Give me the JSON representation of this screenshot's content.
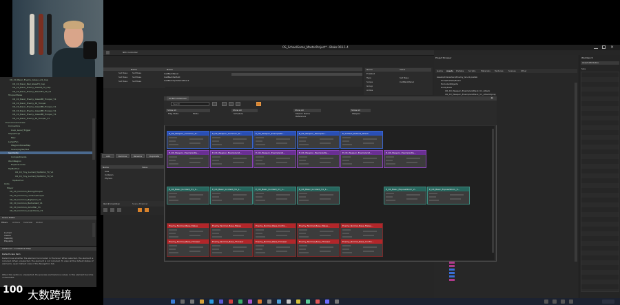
{
  "window": {
    "title": "OS_SchoolGame_MasterProject* - Blake 003.1.4"
  },
  "toolbar": {
    "title": "NPC Controller"
  },
  "dialog": {
    "tab_label": "All BP Containers",
    "search_placeholder": "Search",
    "filters": [
      {
        "header": "Show All",
        "items": [
          "Flag State",
          "Mode"
        ]
      },
      {
        "header": "Show All",
        "items": [
          "Schedule"
        ]
      },
      {
        "header": "Show All",
        "items": [
          "Mission Name",
          "Reference"
        ]
      },
      {
        "header": "Show All",
        "items": [
          "Weapon"
        ]
      }
    ]
  },
  "graph": {
    "rows": [
      {
        "color": "blue",
        "nodes": [
          "E_CR_Weapon_Common_Tr...",
          "E_CR_Weapon_Common_Tr...",
          "E_CR_Weapon_ExampleSt...",
          "E_CR_Weapon_Exemplar...",
          "E_Artifact_Default_Attack"
        ]
      },
      {
        "color": "purple",
        "nodes": [
          "E_CR_Weapon_ExemplarDe...",
          "E_CR_Weapon_ExemplarAt...",
          "E_CR_Weapon_ExemplarAt...",
          "E_CR_Weapon_ExemplarRe...",
          "E_CR_Weapon_ExemplarAt...",
          "E_CR_Weapon_ExemplarDe..."
        ]
      },
      {
        "color": "teal",
        "nodes": [
          "E_CR_Basic_Incident_V1_1...",
          "E_CR_Basic_Incident_V1_1...",
          "E_CR_Basic_Incident_V1_1...",
          "E_CR_Basic_Incident_V1_1...",
          "E_CR_Basic_ExposeWorm_V...",
          "E_CR_Basic_ExposeWorm_V..."
        ]
      },
      {
        "color": "red",
        "nodes": [
          "Enemy_Normal_Base_Melee",
          "Enemy_Normal_Base_Melee",
          "Enemy_Normal_Base_Confro...",
          "Enemy_Normal_Base_Melee...",
          "Enemy_Normal_Base_Melee..."
        ]
      },
      {
        "color": "red",
        "nodes": [
          "Enemy_Normal_Base_Thrower",
          "Enemy_Normal_Base_Thrower",
          "Enemy_Normal_Base_Thrower",
          "Enemy_Normal_Base_Thrower",
          "Enemy_Normal_Base_Confro..."
        ]
      }
    ]
  },
  "left_tree": [
    "CR_XX_Basic_Enemy_Glass_Lvl1_Cap",
    "CR_XX_Basic_Bad_GlassFX_Cap",
    "CR_XX_Basic_Enemy_GlassB_FX_Cap",
    "CR_XX_Basic_Enemy_ShieldFX_FX_V1",
    "TrooperMelee",
    "CR_XX_Basic_Enemy_GlassMB_Trooper_V1",
    "CR_XX_Basic_Enemy_Mi_Trooper",
    "CR_XX_Basic_Enemy_GlassMB_Trooper_V1",
    "CR_XX_Basic_Enemy_GlassMB_Trooper_V1",
    "CR_XX_Basic_Enemy_GlassMB_Trooper_V1",
    "CR_XX_Basic_Enemy_Mi_Trooper_V1",
    "Environment Areas",
    "Connectors",
    "Loop_Level_Trigger",
    "Traps/Props",
    "Misc",
    "Lamp/Fan",
    "Waypoint/AreaMap",
    "Scene/Lights/Hud",
    "Geometry",
    "Compartments",
    "WorldRegion",
    "ExploreLocale",
    "TopBarHud",
    "CR_XX_Tiny_Locked_TopPatrol_FX_V1",
    "CR_XX_Tiny_Locked_TopPatrol_FX_V1",
    "TopBarHud",
    "Units",
    "Player",
    "CR_XX_Common_Balrog/Trooper",
    "CR_XX_Common_Lantern/Trooper",
    "CR_XX_Common_BigSword_V1",
    "CR_XX_Common_Barbshield_V1",
    "CR_XX_Common_AmorBar_V1",
    "CR_XX_Common_GuardCrew_V1"
  ],
  "left_tree_selected": "Geometry",
  "lower_left": {
    "panel_title": "Scene Editor",
    "tabs": [
      "Filters",
      "Actions",
      "Calendar",
      "Global"
    ],
    "items": [
      "Locked",
      "Visible",
      "Visibility",
      "Playable"
    ],
    "help_title": "Advanced - Contextual Help",
    "help_heading": "Default view item",
    "help_text": "Determines whether the element is included in the level. When selected, the element is included. When unselected, the element is not included. To view all the default states of elements, open Default view of the Navigation tab.",
    "help_text2": "When this option is unselected, the preview and balance values in this element become unavailable."
  },
  "table_top": {
    "col": "Name",
    "rows": [
      [
        "Set Base",
        "Set Base"
      ],
      [
        "Set Base",
        "Set Base"
      ],
      [
        "Set Base",
        "Set Base"
      ]
    ]
  },
  "center_top": {
    "col": "Name",
    "rows": [
      "CallBackPanel",
      "CallBackSetSlot",
      "CallBackUpdateCallback"
    ]
  },
  "props": {
    "header": [
      "Name",
      "Value"
    ],
    "rows": [
      [
        "Enabled",
        ""
      ],
      [
        "Type",
        "Set Base"
      ],
      [
        "Scope",
        "CallBackPanel"
      ],
      [
        "Group",
        ""
      ],
      [
        "Active",
        ""
      ]
    ]
  },
  "midleft": {
    "buttons": [
      "Add",
      "Remove",
      "Rename",
      "Duplicate"
    ],
    "header": [
      "Name",
      "Value"
    ],
    "rows": [
      "Size",
      "Collision",
      "Physics"
    ]
  },
  "lower_mid": {
    "tabs": [
      "Quick Inventory",
      "Scene Explorer"
    ]
  },
  "right_panel": {
    "title": "Project Browser",
    "tabs": [
      "Game",
      "Assets",
      "Prefabs",
      "Scripts",
      "Materials",
      "Textures",
      "Scenes",
      "Other"
    ],
    "tree": [
      "Assets/Characters/Enemy_Grunt.prefab",
      "Tools/Prefabs/Beam",
      "ExcludedObjects",
      "EntityData",
      "CR_XX_Weapon_ExemplarAttack_V1_Attack",
      "CR_XX_Weapon_ExemplarAttack_V1_AttackSpray"
    ]
  },
  "far_right": {
    "title": "Workbench",
    "tab": "Asset Attributes",
    "field": "Size"
  },
  "logo": {
    "mark": "100",
    "text": "大数跨境"
  }
}
